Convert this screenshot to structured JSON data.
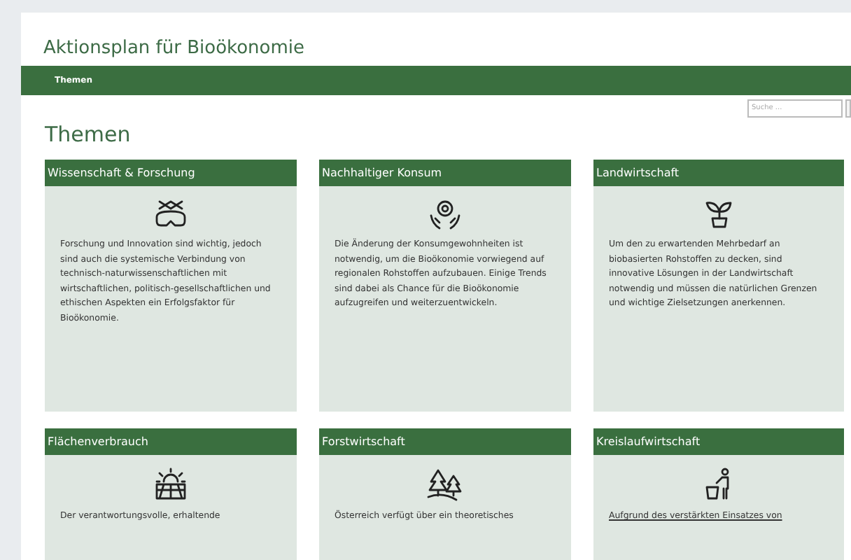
{
  "site_title": "Aktionsplan für Bioökonomie",
  "nav": [
    {
      "label": "Themen",
      "selected": true
    }
  ],
  "search": {
    "placeholder": "Suche ..."
  },
  "heading": "Themen",
  "cards": [
    {
      "title": "Wissenschaft & Forschung",
      "text": "Forschung und Innovation sind wichtig, jedoch sind auch die systemische Verbindung von technisch-naturwissenschaftlichen mit wirtschaftlichen, politisch-gesellschaftlichen und ethischen Aspekten ein Erfolgsfaktor für Bioökonomie.",
      "link": false
    },
    {
      "title": "Nachhaltiger Konsum",
      "text": "Die Änderung der Konsumgewohnheiten ist notwendig, um die Bioökonomie vorwiegend auf regionalen Rohstoffen aufzubauen. Einige Trends sind dabei als Chance für die Bioökonomie aufzugreifen und weiterzuentwickeln.",
      "link": false
    },
    {
      "title": "Landwirtschaft",
      "text": "Um den zu erwartenden Mehrbedarf an biobasierten Rohstoffen zu decken, sind innovative Lösungen in der Landwirtschaft notwendig und müssen die natürlichen Grenzen und wichtige Zielsetzungen anerkennen.",
      "link": false
    },
    {
      "title": "Flächenverbrauch",
      "text": "Der verantwortungsvolle, erhaltende",
      "link": false
    },
    {
      "title": "Forstwirtschaft",
      "text": "Österreich verfügt über ein theoretisches",
      "link": false
    },
    {
      "title": "Kreislaufwirtschaft",
      "text": "Aufgrund des verstärkten Einsatzes von",
      "link": true
    }
  ]
}
